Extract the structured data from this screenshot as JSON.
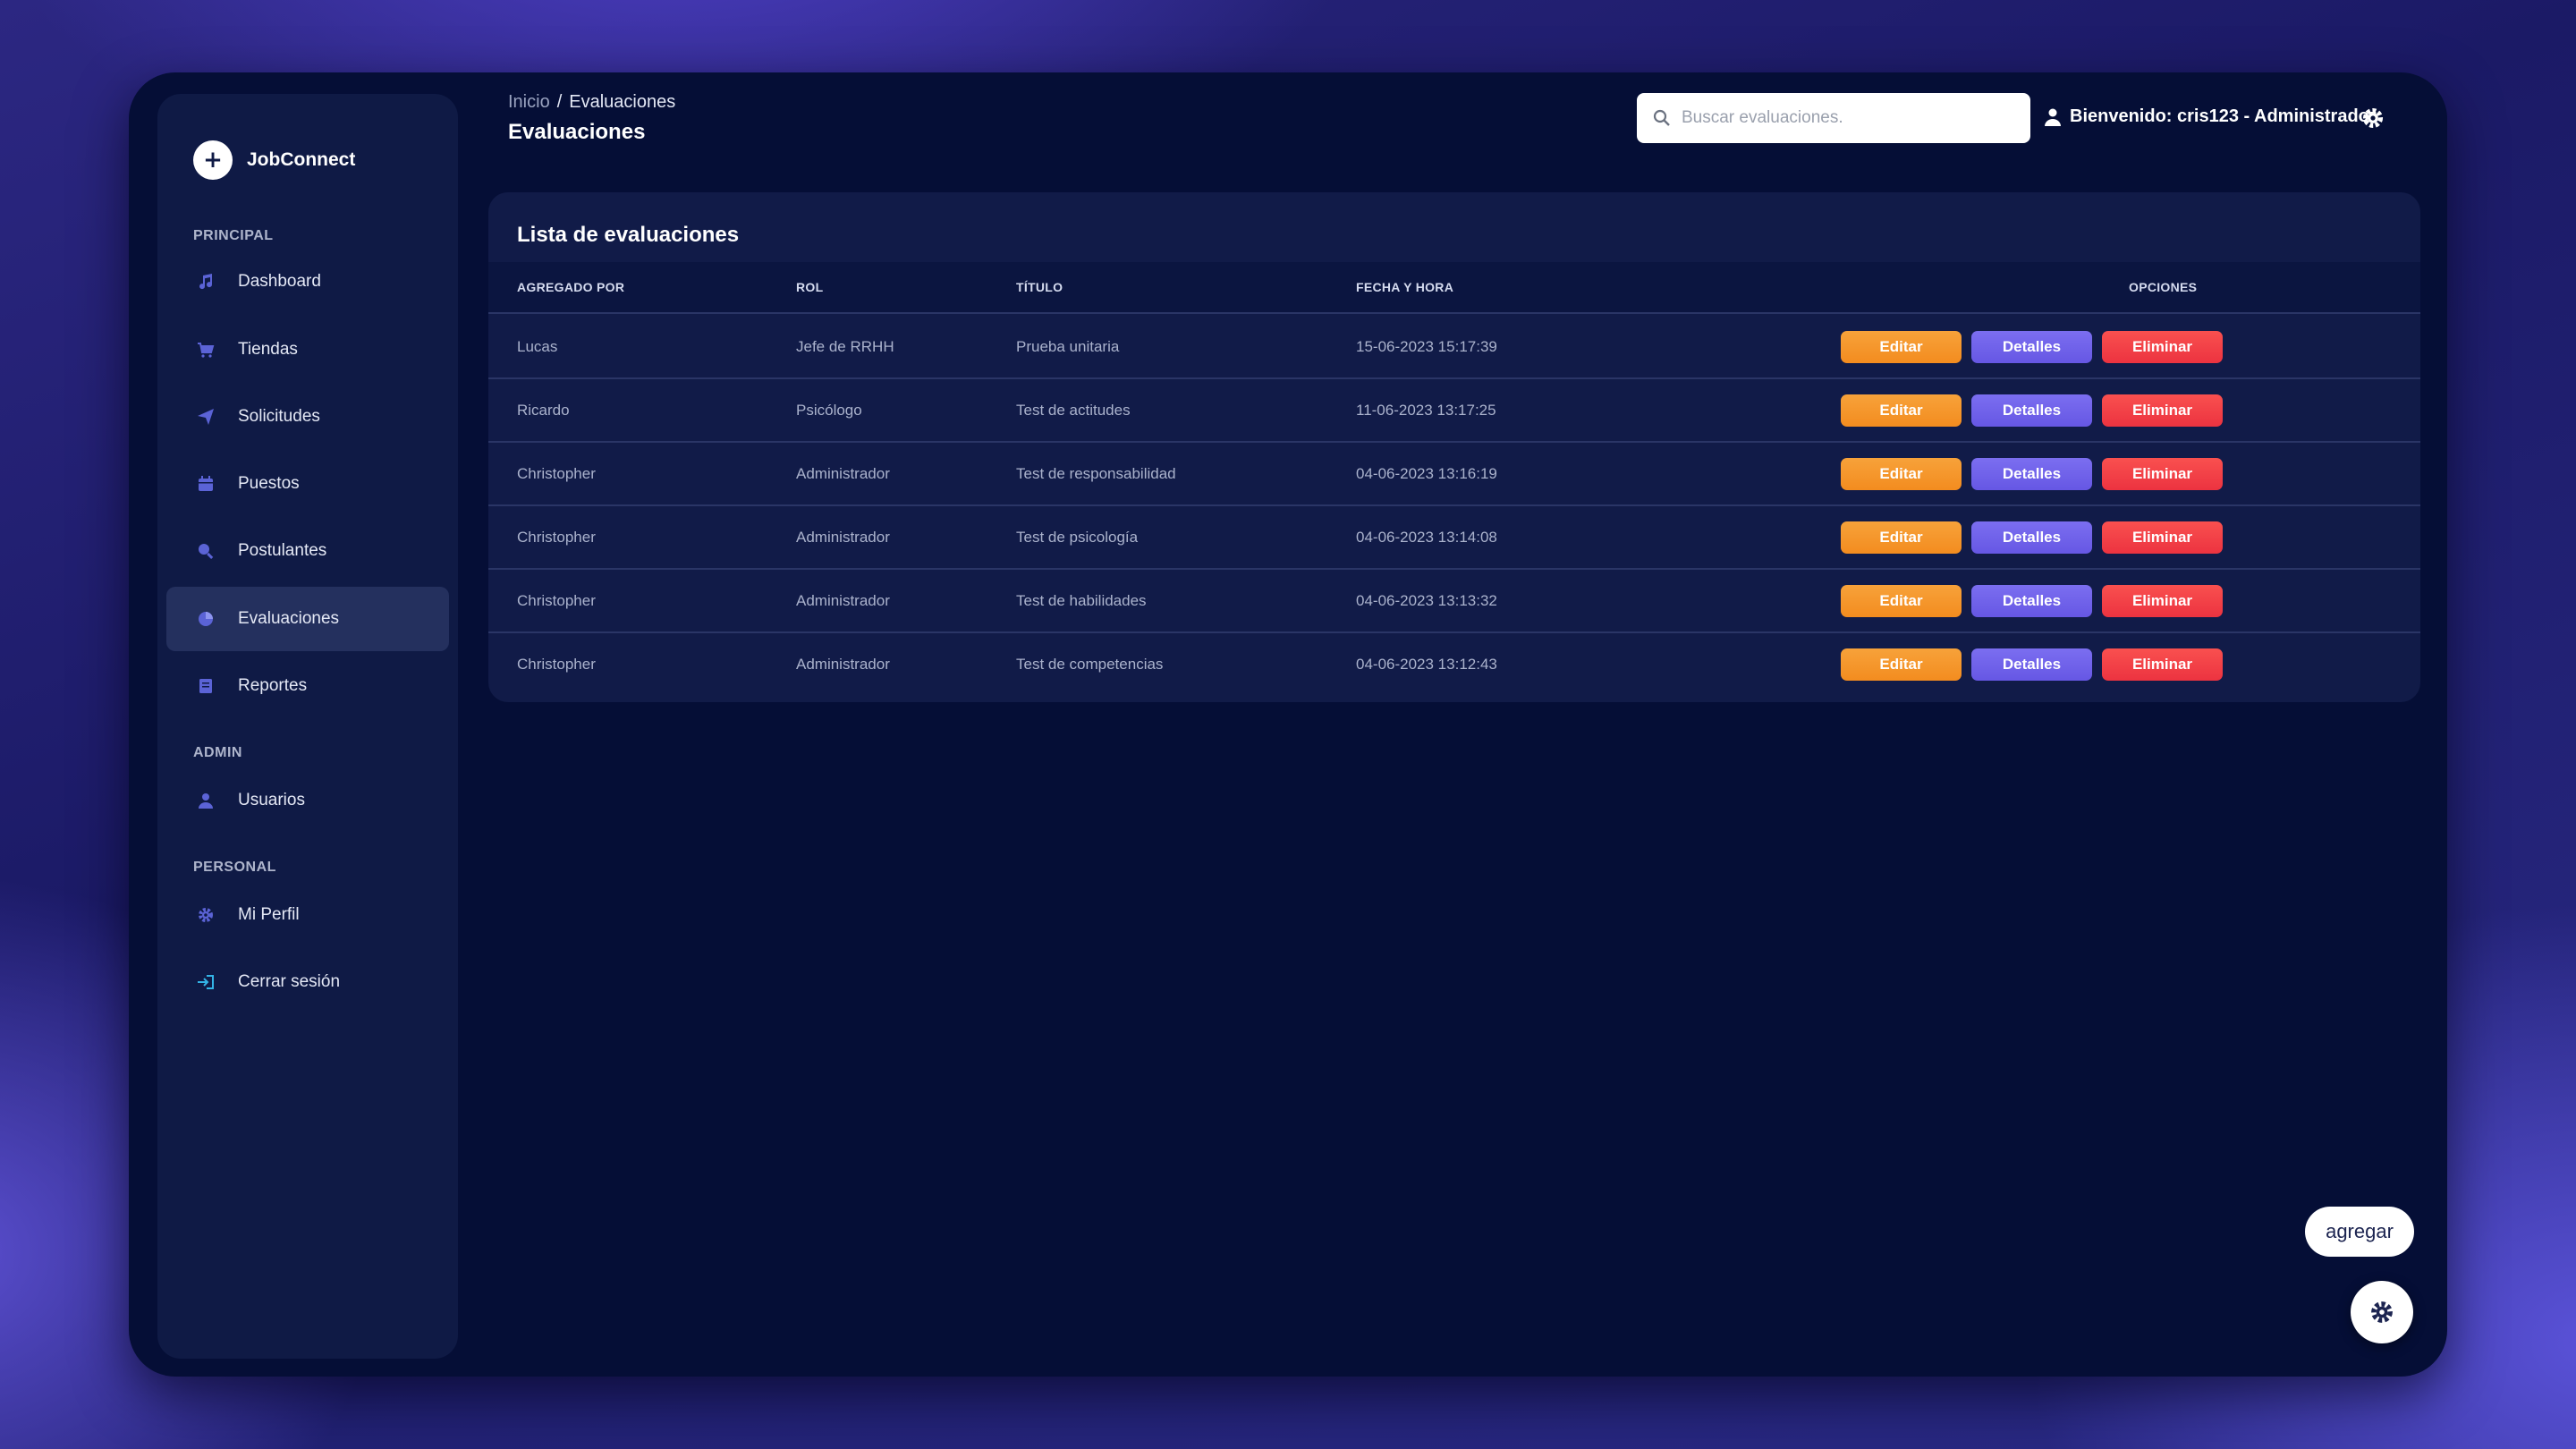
{
  "brand": {
    "name": "JobConnect",
    "logo_glyph": "+"
  },
  "sidebar": {
    "sections": [
      {
        "title": "PRINCIPAL",
        "items": [
          {
            "label": "Dashboard",
            "icon": "music-note-icon"
          },
          {
            "label": "Tiendas",
            "icon": "cart-icon"
          },
          {
            "label": "Solicitudes",
            "icon": "paper-plane-icon"
          },
          {
            "label": "Puestos",
            "icon": "calendar-icon"
          },
          {
            "label": "Postulantes",
            "icon": "search-user-icon"
          },
          {
            "label": "Evaluaciones",
            "icon": "pie-chart-icon",
            "active": true
          },
          {
            "label": "Reportes",
            "icon": "report-icon"
          }
        ]
      },
      {
        "title": "ADMIN",
        "items": [
          {
            "label": "Usuarios",
            "icon": "user-icon"
          }
        ]
      },
      {
        "title": "PERSONAL",
        "items": [
          {
            "label": "Mi Perfil",
            "icon": "gear-icon"
          },
          {
            "label": "Cerrar sesión",
            "icon": "sign-out-icon"
          }
        ]
      }
    ]
  },
  "header": {
    "breadcrumb": {
      "home": "Inicio",
      "separator": "/",
      "current": "Evaluaciones"
    },
    "title": "Evaluaciones",
    "search_placeholder": "Buscar evaluaciones.",
    "welcome": "Bienvenido: cris123 - Administrador"
  },
  "card": {
    "title": "Lista de evaluaciones",
    "columns": [
      "AGREGADO POR",
      "ROL",
      "TÍTULO",
      "FECHA Y HORA",
      "OPCIONES"
    ],
    "buttons": {
      "edit": "Editar",
      "details": "Detalles",
      "delete": "Eliminar"
    },
    "rows": [
      {
        "added_by": "Lucas",
        "role": "Jefe de RRHH",
        "title": "Prueba unitaria",
        "datetime": "15-06-2023 15:17:39"
      },
      {
        "added_by": "Ricardo",
        "role": "Psicólogo",
        "title": "Test de actitudes",
        "datetime": "11-06-2023 13:17:25"
      },
      {
        "added_by": "Christopher",
        "role": "Administrador",
        "title": "Test de responsabilidad",
        "datetime": "04-06-2023 13:16:19"
      },
      {
        "added_by": "Christopher",
        "role": "Administrador",
        "title": "Test de psicología",
        "datetime": "04-06-2023 13:14:08"
      },
      {
        "added_by": "Christopher",
        "role": "Administrador",
        "title": "Test de habilidades",
        "datetime": "04-06-2023 13:13:32"
      },
      {
        "added_by": "Christopher",
        "role": "Administrador",
        "title": "Test de competencias",
        "datetime": "04-06-2023 13:12:43"
      }
    ]
  },
  "floating": {
    "add_label": "agregar",
    "settings_icon": "gear-icon"
  },
  "colors": {
    "edit": "#f38c1f",
    "details": "#6657e4",
    "delete": "#ec3340",
    "app_bg": "#050e36",
    "sidebar_bg": "#0f1a45",
    "icon_accent": "#5b63d6"
  }
}
